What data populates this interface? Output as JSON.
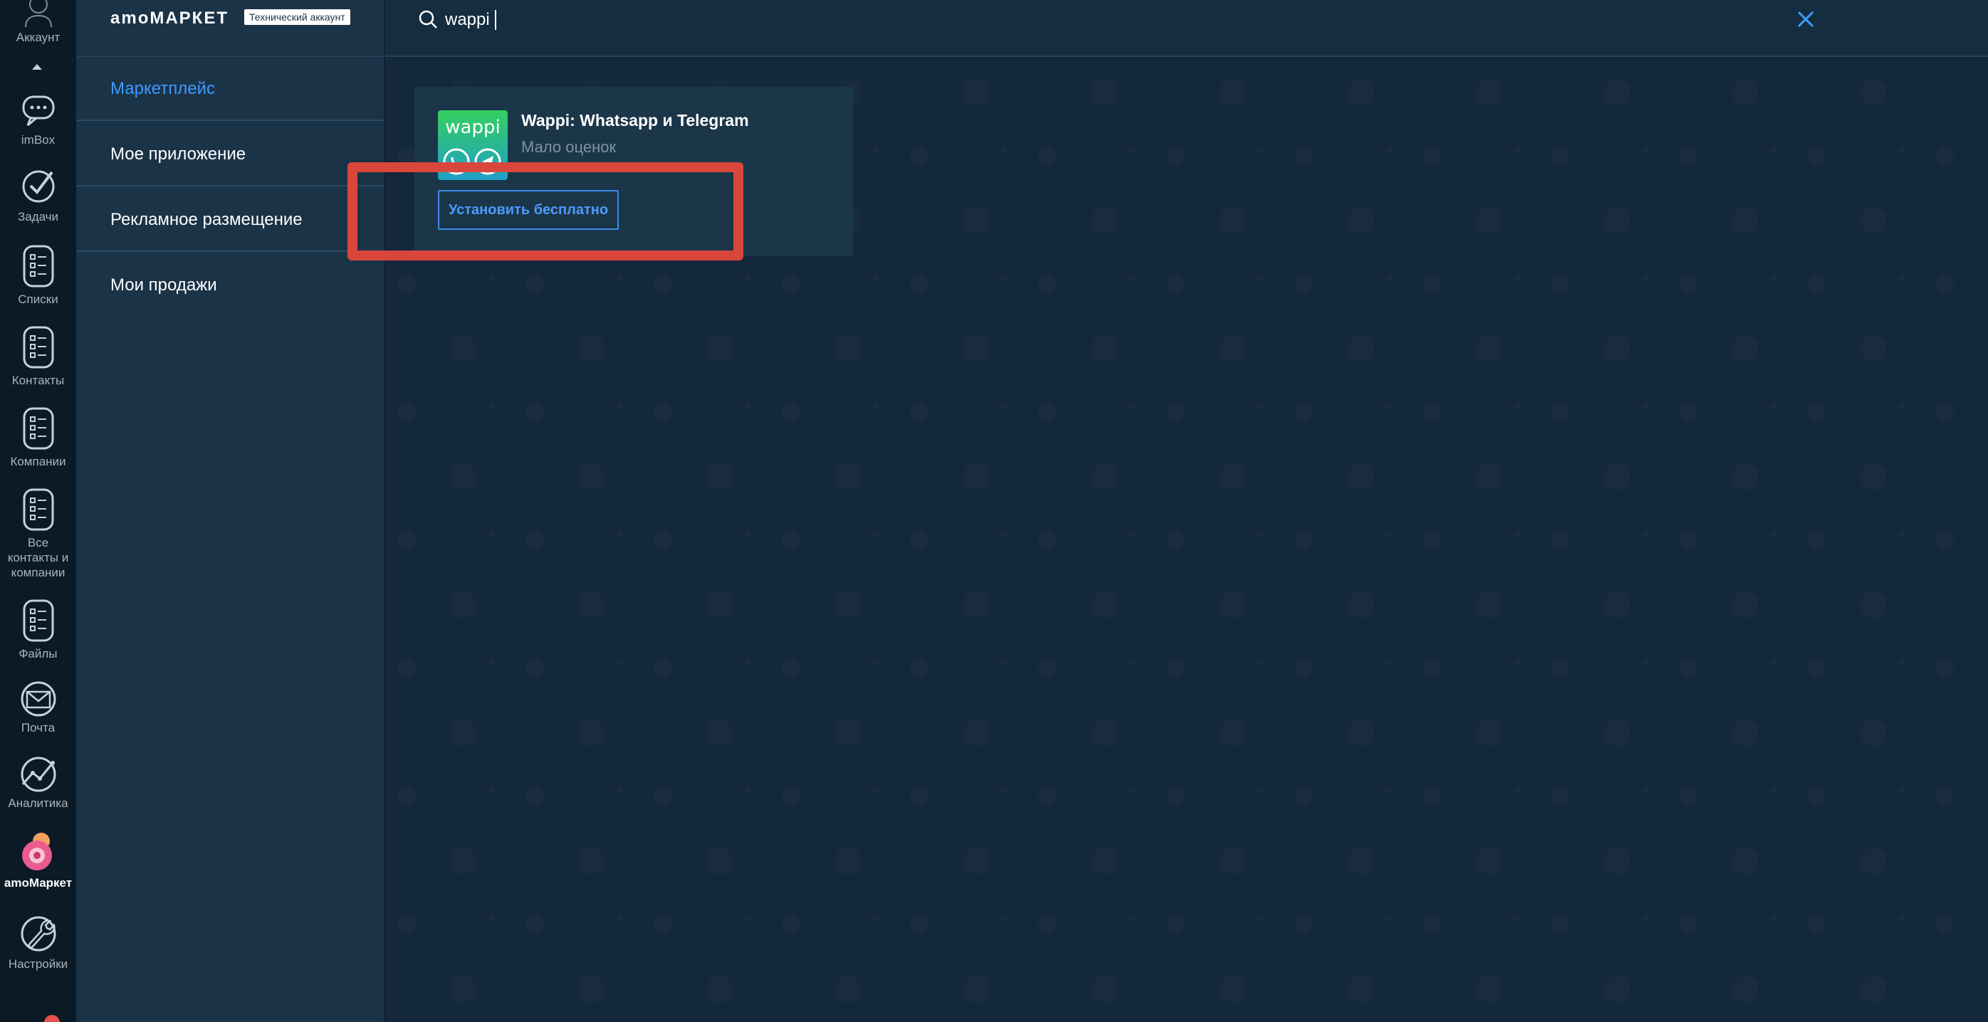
{
  "rail": {
    "items": [
      {
        "label": "Аккаунт",
        "icon": "account-icon"
      },
      {
        "label": "imBox",
        "icon": "chat-icon"
      },
      {
        "label": "Задачи",
        "icon": "check-icon"
      },
      {
        "label": "Списки",
        "icon": "list-icon"
      },
      {
        "label": "Контакты",
        "icon": "list-icon"
      },
      {
        "label": "Компании",
        "icon": "list-icon"
      },
      {
        "label": "Все контакты и компании",
        "icon": "list-icon"
      },
      {
        "label": "Файлы",
        "icon": "list-icon"
      },
      {
        "label": "Почта",
        "icon": "mail-icon"
      },
      {
        "label": "Аналитика",
        "icon": "analytics-icon"
      },
      {
        "label": "amoМаркет",
        "icon": "market-icon",
        "active": true
      },
      {
        "label": "Настройки",
        "icon": "wrench-icon"
      }
    ]
  },
  "menu": {
    "brand": "amoМАРКЕТ",
    "badge": "Технический аккаунт",
    "items": [
      {
        "label": "Маркетплейс",
        "active": true
      },
      {
        "label": "Мое приложение"
      },
      {
        "label": "Рекламное размещение"
      },
      {
        "label": "Мои продажи"
      }
    ]
  },
  "search": {
    "value": "wappi"
  },
  "app": {
    "logo_text": "wappi",
    "title": "Wappi: Whatsapp и Telegram",
    "rating": "Мало оценок",
    "install_label": "Установить бесплатно"
  },
  "colors": {
    "accent": "#3d9bff",
    "highlight": "#d9473c",
    "logo_green": "#2fc45c"
  }
}
